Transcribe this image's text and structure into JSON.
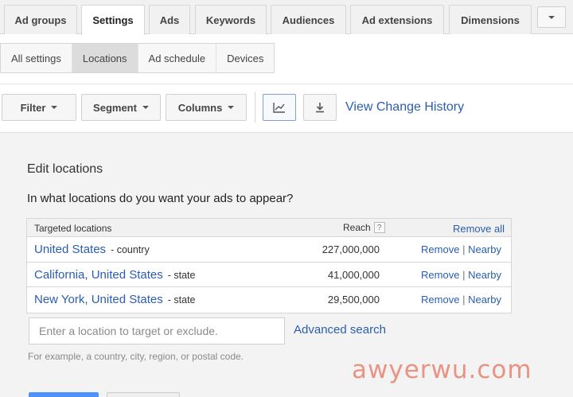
{
  "tabs": [
    {
      "label": "Ad groups",
      "active": false
    },
    {
      "label": "Settings",
      "active": true
    },
    {
      "label": "Ads",
      "active": false
    },
    {
      "label": "Keywords",
      "active": false
    },
    {
      "label": "Audiences",
      "active": false
    },
    {
      "label": "Ad extensions",
      "active": false
    },
    {
      "label": "Dimensions",
      "active": false
    }
  ],
  "tab_more_icon": "chevron-down-icon",
  "subtabs": [
    {
      "label": "All settings",
      "active": false
    },
    {
      "label": "Locations",
      "active": true
    },
    {
      "label": "Ad schedule",
      "active": false
    },
    {
      "label": "Devices",
      "active": false
    }
  ],
  "toolbar": {
    "filter_label": "Filter",
    "segment_label": "Segment",
    "columns_label": "Columns",
    "chart_icon": "line-chart-icon",
    "download_icon": "download-icon",
    "view_history_label": "View Change History"
  },
  "edit_locations": {
    "title": "Edit locations",
    "question": "In what locations do you want your ads to appear?",
    "table": {
      "col_targeted": "Targeted locations",
      "col_reach": "Reach",
      "help_mark": "?",
      "remove_all": "Remove all",
      "rows": [
        {
          "name": "United States",
          "type": "- country",
          "reach": "227,000,000",
          "remove": "Remove",
          "sep": "|",
          "nearby": "Nearby"
        },
        {
          "name": "California, United States",
          "type": "- state",
          "reach": "41,000,000",
          "remove": "Remove",
          "sep": "|",
          "nearby": "Nearby"
        },
        {
          "name": "New York, United States",
          "type": "- state",
          "reach": "29,500,000",
          "remove": "Remove",
          "sep": "|",
          "nearby": "Nearby"
        }
      ]
    },
    "search_placeholder": "Enter a location to target or exclude.",
    "advanced_search": "Advanced search",
    "hint": "For example, a country, city, region, or postal code."
  },
  "watermark": "awyerwu.com",
  "colors": {
    "link": "#2a5db0",
    "accent_border": "#7ea0d6",
    "watermark": "#e89384",
    "primary_button": "#4d90fe"
  }
}
